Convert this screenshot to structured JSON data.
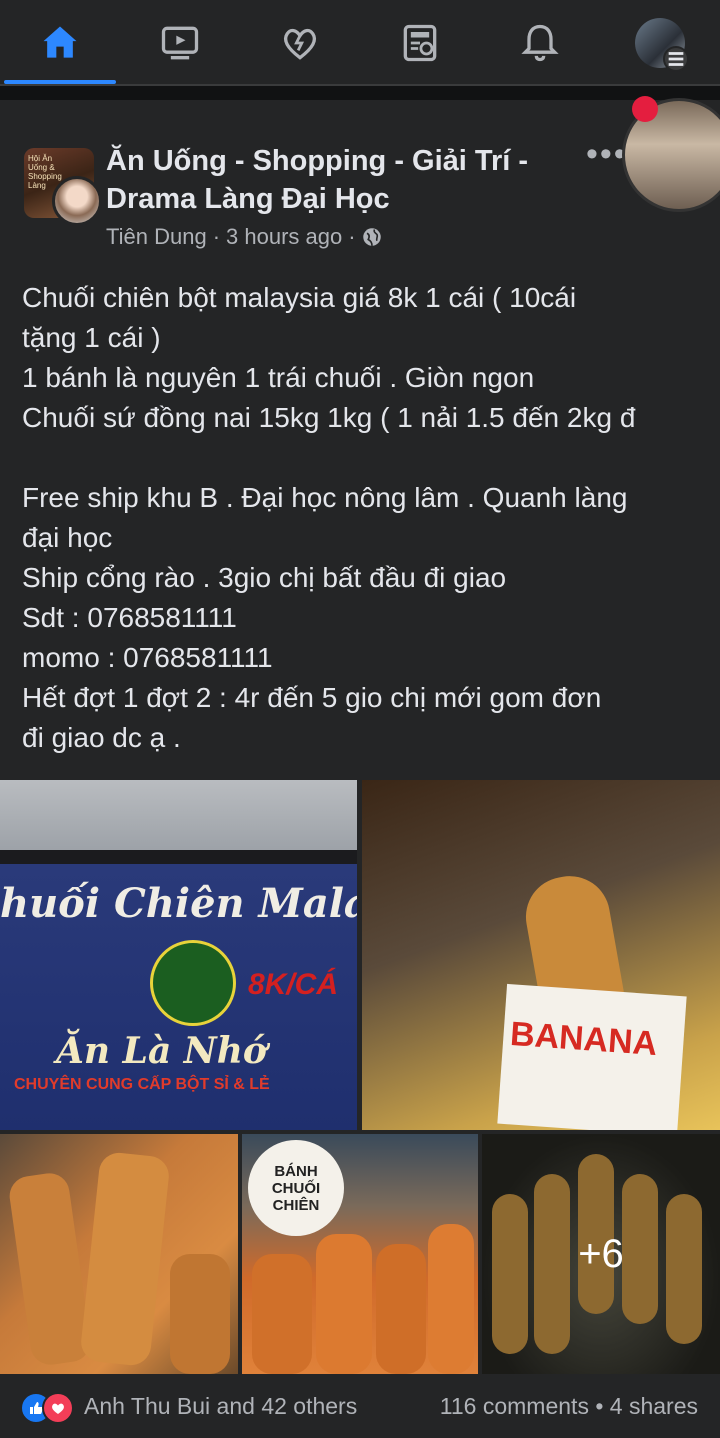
{
  "nav": {
    "items": [
      "home-icon",
      "watch-icon",
      "dating-icon",
      "news-icon",
      "notifications-icon",
      "menu-avatar"
    ],
    "active": "home",
    "accent": "#2d88ff"
  },
  "post": {
    "group_avatar_text": "Hội Ăn Uống & Shopping Làng",
    "group_name": "Ăn Uống - Shopping - Giải Trí - Drama Làng Đại Học",
    "author": "Tiên Dung",
    "time": "3 hours ago",
    "privacy_icon": "globe-icon",
    "text_lines": [
      "Chuối chiên bột malaysia giá 8k 1 cái ( 10cái",
      "tặng 1 cái )",
      "1 bánh là nguyên 1 trái chuối . Giòn ngon",
      "Chuối sứ đồng nai 15kg 1kg ( 1 nải 1.5 đến 2kg đ",
      "",
      "Free ship khu B . Đại học nông lâm . Quanh làng",
      "đại học",
      "Ship cổng rào . 3gio chị bất đầu đi giao",
      "Sdt : 0768581111",
      "momo : 0768581111",
      "Hết đợt 1 đợt 2 : 4r đến 5 gio chị mới gom đơn",
      "đi giao dc ạ ."
    ],
    "photos": {
      "p1_sign": "huối Chiên Malays",
      "p1_price": "8K/CÁ",
      "p1_slogan": "Ăn Là Nhớ",
      "p1_sub": "CHUYÊN CUNG CẤP BỘT SỈ & LẺ",
      "p2_bag": "BANANA",
      "p4_badge": [
        "BÁNH",
        "CHUỐI",
        "CHIÊN"
      ],
      "more_count": "+6"
    },
    "reactions_text": "Anh Thu Bui and 42 others",
    "comments_shares": "116 comments • 4 shares"
  }
}
